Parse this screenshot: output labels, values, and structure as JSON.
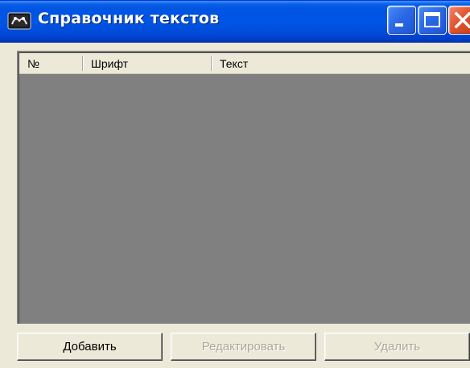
{
  "window": {
    "title": "Справочник текстов",
    "icon": "app-icon",
    "controls": {
      "minimize": "minimize-icon",
      "maximize": "maximize-icon",
      "close": "close-icon"
    }
  },
  "list": {
    "columns": [
      "№",
      "Шрифт",
      "Текст"
    ],
    "rows": []
  },
  "buttons": {
    "add": "Добавить",
    "edit": "Редактировать",
    "delete": "Удалить"
  },
  "colors": {
    "titlebar": "#0054e3",
    "list_background": "#808080",
    "face": "#ece9d8",
    "disabled_text": "#aca899",
    "close_button": "#e2542c"
  }
}
